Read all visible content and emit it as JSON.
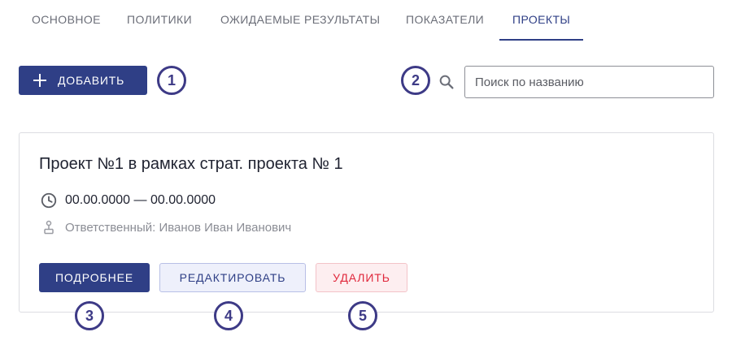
{
  "tabs": [
    {
      "label": "ОСНОВНОЕ"
    },
    {
      "label": "ПОЛИТИКИ"
    },
    {
      "label": "ОЖИДАЕМЫЕ РЕЗУЛЬТАТЫ"
    },
    {
      "label": "ПОКАЗАТЕЛИ"
    },
    {
      "label": "ПРОЕКТЫ",
      "active": true
    }
  ],
  "toolbar": {
    "add_label": "ДОБАВИТЬ",
    "search_placeholder": "Поиск по названию"
  },
  "markers": [
    "1",
    "2",
    "3",
    "4",
    "5"
  ],
  "project": {
    "title": "Проект №1 в рамках страт. проекта № 1",
    "dates": "00.00.0000 — 00.00.0000",
    "owner": "Ответственный: Иванов Иван Иванович",
    "details_label": "ПОДРОБНЕЕ",
    "edit_label": "РЕДАКТИРОВАТЬ",
    "delete_label": "УДАЛИТЬ"
  },
  "colors": {
    "primary": "#2f3f86",
    "marker": "#3d3a86",
    "danger": "#e0283c",
    "edit_bg": "#eef0fb",
    "delete_bg": "#fdeef0"
  },
  "icons": [
    "plus-icon",
    "search-icon",
    "clock-icon",
    "person-icon"
  ]
}
